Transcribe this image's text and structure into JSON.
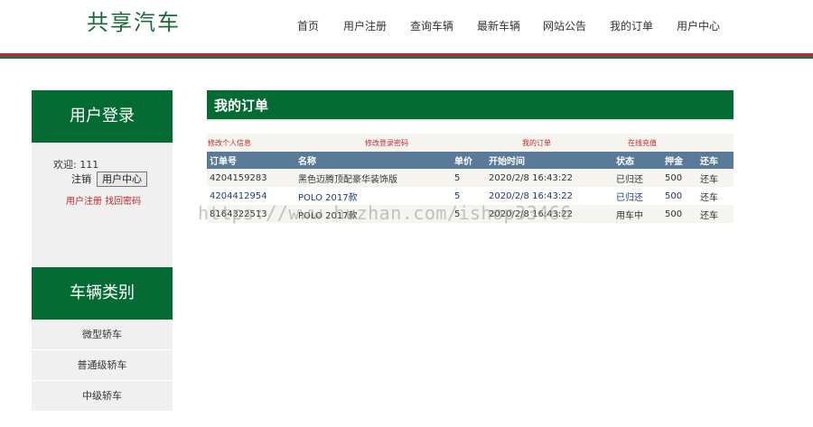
{
  "site": {
    "logo": "共享汽车"
  },
  "nav": {
    "items": [
      "首页",
      "用户注册",
      "查询车辆",
      "最新车辆",
      "网站公告",
      "我的订单",
      "用户中心"
    ]
  },
  "sidebar": {
    "login_title": "用户登录",
    "welcome_text": "欢迎: 111",
    "logout_label": "注销",
    "user_center_label": "用户中心",
    "register_link": "用户注册",
    "forgot_link": "找回密码",
    "category_title": "车辆类别",
    "categories": [
      "微型轿车",
      "普通级轿车",
      "中级轿车"
    ]
  },
  "main": {
    "title": "我的订单",
    "subnav": [
      "修改个人信息",
      "修改登录密码",
      "我的订单",
      "在线充值"
    ],
    "table": {
      "headers": [
        "订单号",
        "名称",
        "单价",
        "开始时间",
        "状态",
        "押金",
        "还车"
      ],
      "rows": [
        [
          "4204159283",
          "黑色迈腾顶配豪华装饰版",
          "5",
          "2020/2/8 16:43:22",
          "已归还",
          "500",
          "还车"
        ],
        [
          "4204412954",
          "POLO 2017款",
          "5",
          "2020/2/8 16:43:22",
          "已归还",
          "500",
          "还车"
        ],
        [
          "8164322513",
          "POLO 2017款",
          "5",
          "2020/2/8 16:43:22",
          "用车中",
          "500",
          "还车"
        ]
      ]
    }
  },
  "watermark": "https://www.huzhan.com/ishop33466",
  "colors": {
    "brand_green": "#046b33",
    "accent_red": "#c0282f",
    "table_header": "#5a7a9a"
  }
}
